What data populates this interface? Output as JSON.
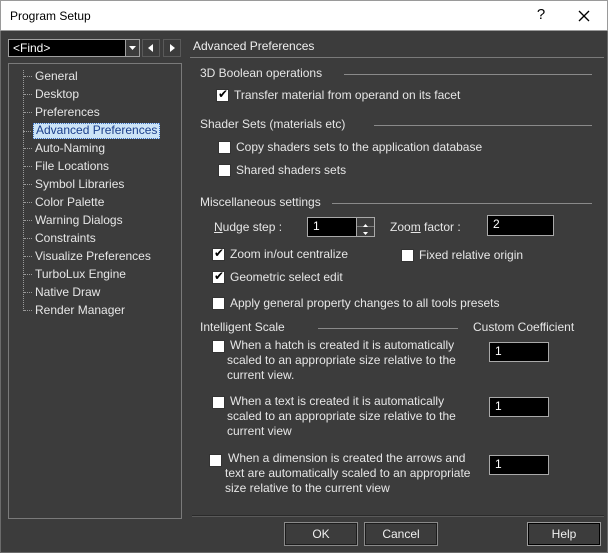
{
  "window": {
    "title": "Program Setup",
    "help_glyph": "?"
  },
  "find": {
    "value": "<Find>"
  },
  "tree": {
    "items": [
      "General",
      "Desktop",
      "Preferences",
      "Advanced Preferences",
      "Auto-Naming",
      "File Locations",
      "Symbol Libraries",
      "Color Palette",
      "Warning Dialogs",
      "Constraints",
      "Visualize Preferences",
      "TurboLux Engine",
      "Native Draw",
      "Render Manager"
    ],
    "selected": "Advanced Preferences"
  },
  "panel": {
    "title": "Advanced Preferences",
    "boolean": {
      "heading": "3D Boolean operations",
      "transfer_material": {
        "label": "Transfer material from operand  on its facet",
        "checked": true
      }
    },
    "shader": {
      "heading": "Shader Sets (materials etc)",
      "copy_sets": {
        "label": "Copy shaders sets to the application database",
        "checked": false
      },
      "shared_sets": {
        "label": "Shared shaders sets",
        "checked": false
      }
    },
    "misc": {
      "heading": "Miscellaneous settings",
      "nudge_label_n": "N",
      "nudge_label_rest": "udge step :",
      "nudge_value": "1",
      "zoom_label_pre": "Zoo",
      "zoom_label_m": "m",
      "zoom_label_rest": " factor :",
      "zoom_value": "2",
      "zoom_centralize": {
        "label": "Zoom in/out centralize",
        "checked": true
      },
      "fixed_origin": {
        "label": "Fixed relative origin",
        "checked": false
      },
      "geometric_select": {
        "label": "Geometric select edit",
        "checked": true
      },
      "apply_general": {
        "label": "Apply general property changes to all tools presets",
        "checked": false
      }
    },
    "scale": {
      "heading": "Intelligent Scale",
      "coef_heading": "Custom Coefficient",
      "hatch": {
        "lines": [
          "When a hatch is created it is automatically",
          "scaled to an appropriate size relative to the",
          "current view."
        ],
        "value": "1",
        "checked": false
      },
      "text": {
        "lines": [
          "When a text is created it is automatically",
          "scaled to an appropriate size relative to the",
          "current view"
        ],
        "value": "1",
        "checked": false
      },
      "dimension": {
        "lines": [
          "When a dimension is created the arrows and",
          "text are automatically scaled to an appropriate",
          "size relative to the current view"
        ],
        "value": "1",
        "checked": false
      }
    }
  },
  "buttons": {
    "ok": "OK",
    "cancel": "Cancel",
    "help": "Help"
  }
}
